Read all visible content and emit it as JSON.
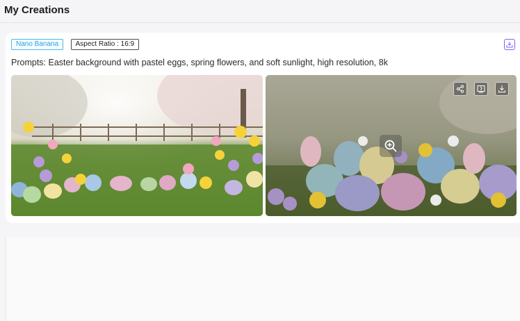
{
  "header": {
    "title": "My Creations"
  },
  "card": {
    "model_tag": "Nano Banana",
    "aspect_tag": "Aspect Ratio : 16:9",
    "prompt": "Prompts: Easter background with pastel eggs, spring flowers, and soft sunlight, high resolution, 8k"
  },
  "icons": {
    "download": "download-icon",
    "share": "share-icon",
    "edit": "image-edit-icon",
    "zoom": "zoom-in-icon"
  },
  "colors": {
    "accent_purple": "#7b61ff",
    "tag_blue": "#2aa3dc"
  }
}
